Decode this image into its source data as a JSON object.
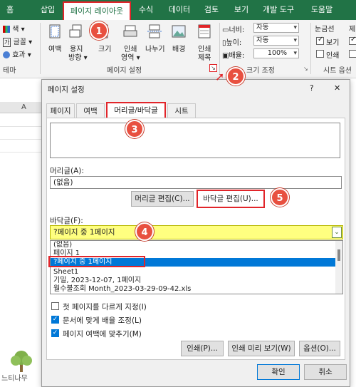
{
  "tabs": [
    "홈",
    "삽입",
    "페이지 레이아웃",
    "수식",
    "데이터",
    "검토",
    "보기",
    "개발 도구",
    "도움말"
  ],
  "ribbon": {
    "theme_items": [
      "색 ▾",
      "글꼴 ▾",
      "효과 ▾"
    ],
    "theme_label": "테마",
    "margin": "여백",
    "orientation": [
      "용지",
      "방향 ▾"
    ],
    "size": "크기",
    "print_area": [
      "인쇄",
      "영역 ▾"
    ],
    "breaks": "나누기",
    "background": "배경",
    "print_titles": [
      "인쇄",
      "제목"
    ],
    "page_setup_label": "페이지 설정",
    "width_label": "너비:",
    "width_value": "자동",
    "height_label": "높이:",
    "height_value": "자동",
    "scale_label": "배율:",
    "scale_value": "100%",
    "scale_group_label": "크기 조정",
    "gridlines_label": "눈금선",
    "view_label": "보기",
    "print_label": "인쇄",
    "sheet_options_label": "시트 옵션",
    "headings_partial": "제"
  },
  "sheet": {
    "column_a": "A"
  },
  "dialog": {
    "title": "페이지 설정",
    "help": "?",
    "close": "✕",
    "tabs": [
      "페이지",
      "여백",
      "머리글/바닥글",
      "시트"
    ],
    "header_label": "머리글(A):",
    "header_value": "(없음)",
    "edit_header_btn": "머리글 편집(C)...",
    "edit_footer_btn": "바닥글 편집(U)...",
    "footer_label": "바닥글(F):",
    "footer_value": "?페이지 중 1페이지",
    "footer_options": [
      "(없음)",
      "페이지 1",
      "?페이지 중 1페이지",
      "Sheet1",
      " 기밀, 2023-12-07, 1페이지",
      "월수불조회 Month_2023-03-29-09-42.xls"
    ],
    "checkboxes": [
      {
        "label": "첫 페이지를 다르게 지정(I)",
        "checked": false
      },
      {
        "label": "문서에 맞게 배율 조정(L)",
        "checked": true
      },
      {
        "label": "페이지 여백에 맞추기(M)",
        "checked": true
      }
    ],
    "print_btn": "인쇄(P)...",
    "preview_btn": "인쇄 미리 보기(W)",
    "options_btn": "옵션(O)...",
    "ok_btn": "확인",
    "cancel_btn": "취소"
  },
  "badges": [
    "1",
    "2",
    "3",
    "4",
    "5"
  ],
  "watermark": "느티나무",
  "colors": {
    "excel_green": "#217346",
    "highlight_red": "#e1252a",
    "selection_blue": "#0078d7",
    "footer_yellow": "#ffff80",
    "badge": "#e85040"
  }
}
